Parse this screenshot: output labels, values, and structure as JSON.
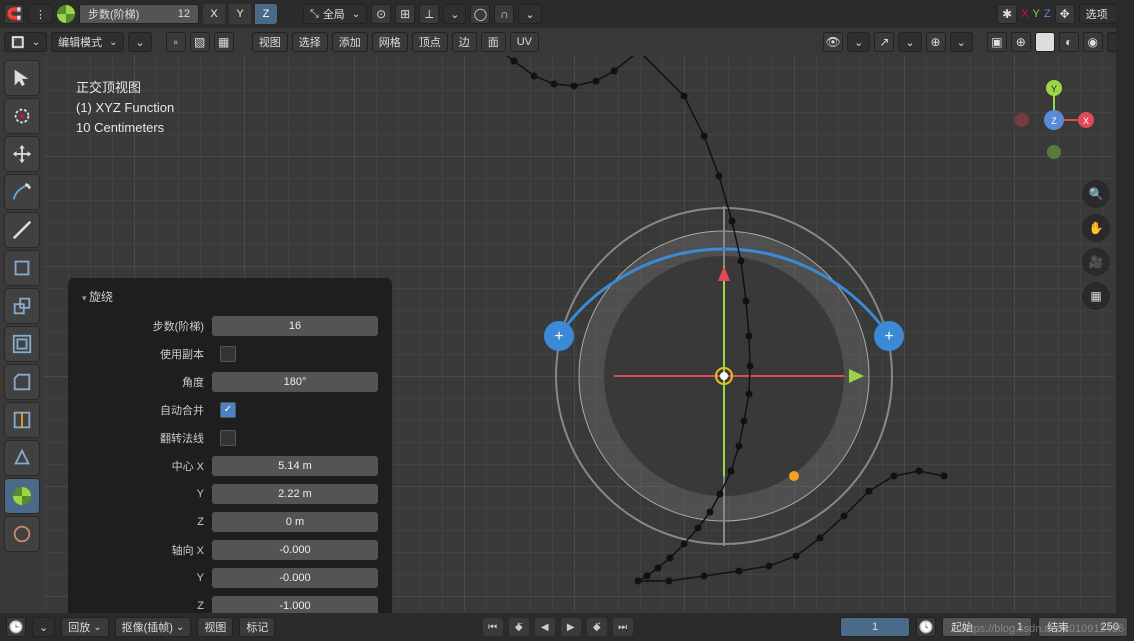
{
  "topbar": {
    "snap_icon": "magnet",
    "steps_label": "步数(阶梯)",
    "steps_value": "12",
    "axis_x": "X",
    "axis_y": "Y",
    "axis_z": "Z",
    "orientation_label": "全局",
    "options_label": "选项"
  },
  "topbar2": {
    "mode_label": "编辑模式",
    "menus": [
      "视图",
      "选择",
      "添加",
      "网格",
      "顶点",
      "边",
      "面",
      "UV"
    ]
  },
  "overlay": {
    "view_name": "正交顶视图",
    "object_name": "(1) XYZ Function",
    "scale": "10 Centimeters"
  },
  "op_panel": {
    "title": "旋绕",
    "rows": {
      "steps_label": "步数(阶梯)",
      "steps_value": "16",
      "dup_label": "使用副本",
      "angle_label": "角度",
      "angle_value": "180°",
      "automerge_label": "自动合并",
      "flipnorm_label": "翻转法线",
      "center_x_label": "中心 X",
      "center_x_value": "5.14 m",
      "center_y_label": "Y",
      "center_y_value": "2.22 m",
      "center_z_label": "Z",
      "center_z_value": "0 m",
      "axis_x_label": "轴向 X",
      "axis_x_value": "-0.000",
      "axis_y_label": "Y",
      "axis_y_value": "-0.000",
      "axis_z_label": "Z",
      "axis_z_value": "-1.000"
    }
  },
  "nav_gizmo": {
    "x": "X",
    "y": "Y",
    "z": "Z"
  },
  "timeline": {
    "playback_label": "回放",
    "keying_label": "抠像(插帧)",
    "view_label": "视图",
    "marker_label": "标记",
    "frame_current": "1",
    "start_label": "起始",
    "start_value": "1",
    "end_label": "结束",
    "end_value": "250"
  },
  "watermark": "https://blog.csdn.net/u010912436"
}
